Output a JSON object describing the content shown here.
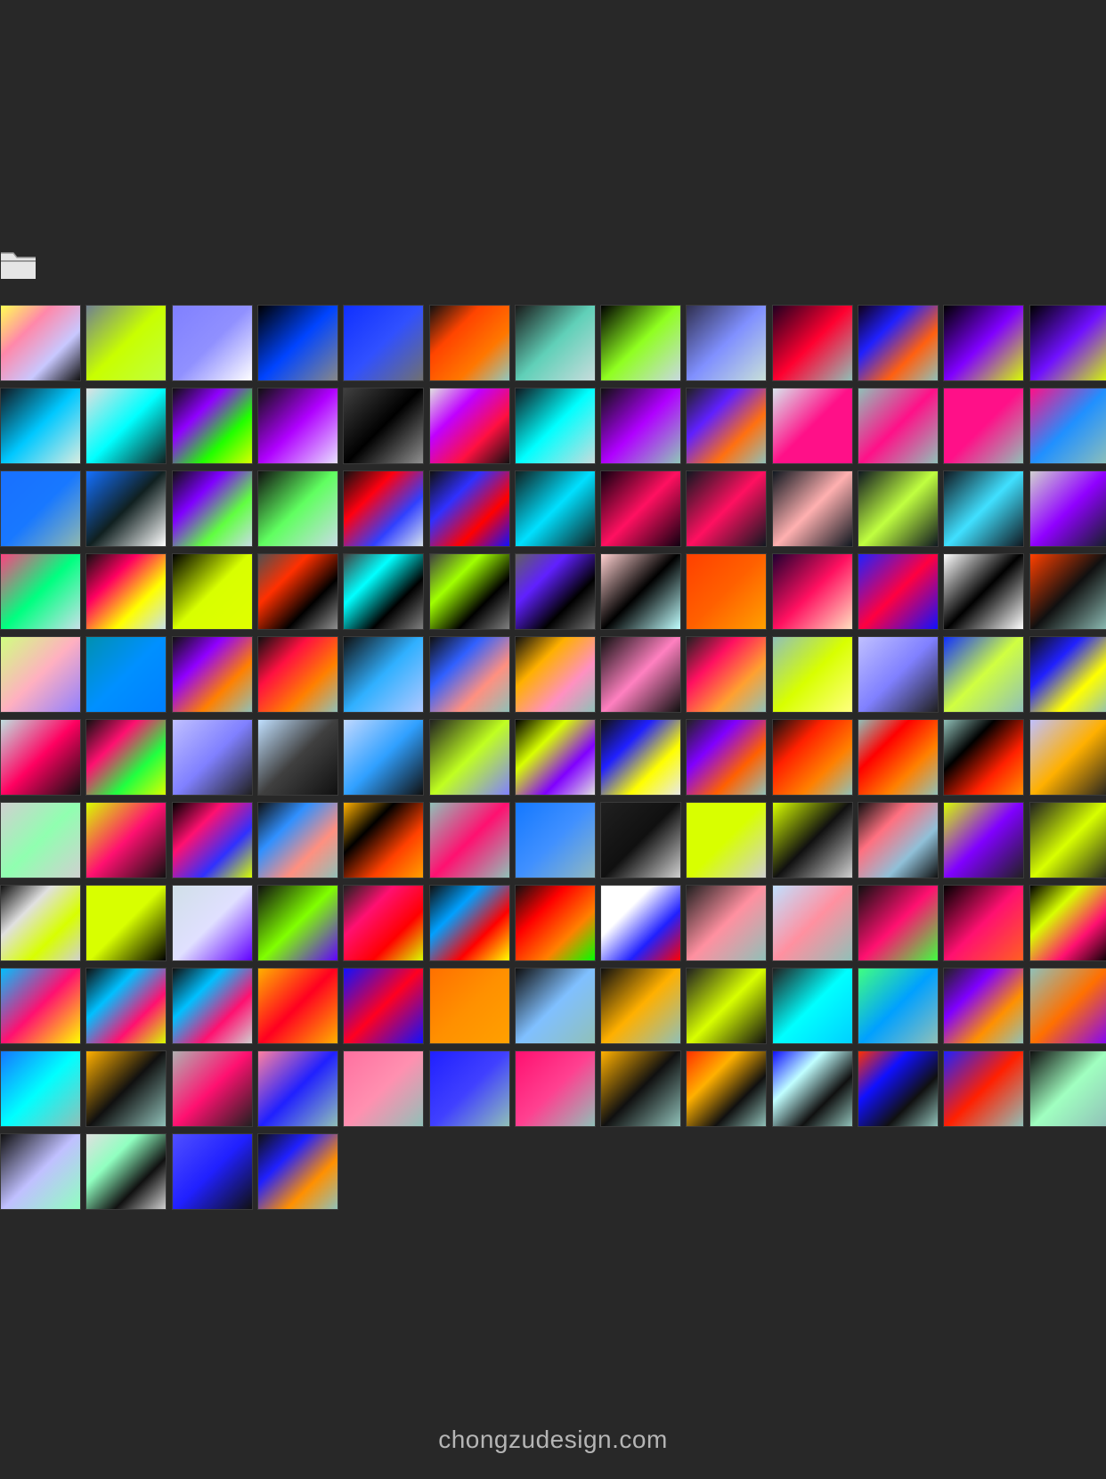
{
  "panel": {
    "folder_icon": "folder-icon",
    "background_color": "#282828"
  },
  "swatches": [
    [
      "#ffff55",
      "#ff88aa",
      "#c8c8ff",
      "#111111"
    ],
    [
      "#708090",
      "#c8ff00",
      "#c0ff40"
    ],
    [
      "#8080ff",
      "#9090ff",
      "#ffffff"
    ],
    [
      "#000000",
      "#0044ff",
      "#888888"
    ],
    [
      "#1030ff",
      "#3050ff",
      "#707070"
    ],
    [
      "#111111",
      "#ff4400",
      "#ff7700",
      "#90c8c0"
    ],
    [
      "#1a1a1a",
      "#60d0b8",
      "#c8dcdc"
    ],
    [
      "#000000",
      "#90ff20",
      "#c8d8e0"
    ],
    [
      "#303050",
      "#8090ff",
      "#c8e0d8"
    ],
    [
      "#200020",
      "#ff0030",
      "#90c0b8"
    ],
    [
      "#100018",
      "#2020ff",
      "#ff6010",
      "#90c0b8"
    ],
    [
      "#000000",
      "#8000ff",
      "#d8ff00"
    ],
    [
      "#000000",
      "#7010ff",
      "#d8ff00"
    ],
    [
      "#101820",
      "#00c8ff",
      "#d8ece0"
    ],
    [
      "#e0e0e0",
      "#00ffff",
      "#102020"
    ],
    [
      "#101010",
      "#9000ff",
      "#20ff00",
      "#d8ff00"
    ],
    [
      "#101010",
      "#b000ff",
      "#e8e0ff"
    ],
    [
      "#404040",
      "#000000",
      "#909090"
    ],
    [
      "#e0e0e0",
      "#c000ff",
      "#ff1040",
      "#101010"
    ],
    [
      "#101820",
      "#00ffff",
      "#c8dcdc"
    ],
    [
      "#101010",
      "#b000ff",
      "#90c8b8"
    ],
    [
      "#202020",
      "#6020ff",
      "#ff7010",
      "#90c0b8"
    ],
    [
      "#d8e4ec",
      "#ff1088",
      "#ff1088"
    ],
    [
      "#90c0b8",
      "#ff1088",
      "#90c0b8"
    ],
    [
      "#ff1088",
      "#ff1088",
      "#90c0b8"
    ],
    [
      "#ff1088",
      "#2090ff",
      "#90c0b8"
    ],
    [
      "#1870ff",
      "#1878ff",
      "#90b8b0"
    ],
    [
      "#1470ff",
      "#102020",
      "#ffffff"
    ],
    [
      "#101010",
      "#8000ff",
      "#60ff40",
      "#c8dce4"
    ],
    [
      "#101010",
      "#60ff60",
      "#c8dce4"
    ],
    [
      "#101010",
      "#ff0010",
      "#3040ff",
      "#d8e4ec"
    ],
    [
      "#101010",
      "#3030ff",
      "#ff0000",
      "#1010ff"
    ],
    [
      "#102020",
      "#00e0ff",
      "#102020"
    ],
    [
      "#100010",
      "#ff1060",
      "#100010"
    ],
    [
      "#101820",
      "#ff1060",
      "#101820"
    ],
    [
      "#101820",
      "#ffb0b0",
      "#101820"
    ],
    [
      "#101820",
      "#c0ff40",
      "#101820"
    ],
    [
      "#101820",
      "#40e0ff",
      "#101820"
    ],
    [
      "#d0d0d0",
      "#9000ff",
      "#102020"
    ],
    [
      "#ff4080",
      "#00ff80",
      "#c8e0e8"
    ],
    [
      "#101010",
      "#ff0060",
      "#ffff00",
      "#c8e0e8"
    ],
    [
      "#000000",
      "#d8ff00",
      "#e0ff00"
    ],
    [
      "#505050",
      "#ff3000",
      "#000000",
      "#909090"
    ],
    [
      "#404040",
      "#00ffff",
      "#000000",
      "#808080"
    ],
    [
      "#404040",
      "#a0ff00",
      "#000000",
      "#808080"
    ],
    [
      "#606060",
      "#6020ff",
      "#000000",
      "#707070"
    ],
    [
      "#ffd0d0",
      "#000000",
      "#c0ffff"
    ],
    [
      "#ff4000",
      "#ff6000",
      "#ffa000"
    ],
    [
      "#200030",
      "#ff1060",
      "#ffe0c0"
    ],
    [
      "#2020ff",
      "#ff0040",
      "#1010ff"
    ],
    [
      "#ffffff",
      "#000000",
      "#ffffff"
    ],
    [
      "#ff4000",
      "#101010",
      "#90c0b8"
    ],
    [
      "#d0ff80",
      "#ffb0c0",
      "#9080ff"
    ],
    [
      "#0090b0",
      "#0090ff",
      "#0080ff"
    ],
    [
      "#101010",
      "#9000ff",
      "#ff8000",
      "#90c0b8"
    ],
    [
      "#101010",
      "#ff1040",
      "#ff8000",
      "#90c0b8"
    ],
    [
      "#101010",
      "#30b0ff",
      "#b0c8ff"
    ],
    [
      "#101010",
      "#3060ff",
      "#ff9080",
      "#90c0b8"
    ],
    [
      "#101010",
      "#ffb000",
      "#ff90c0",
      "#90c0b8"
    ],
    [
      "#101010",
      "#ff80c0",
      "#101010"
    ],
    [
      "#202020",
      "#ff1060",
      "#ffa030",
      "#90c0b8"
    ],
    [
      "#90c0b8",
      "#d8ff00",
      "#ffff80"
    ],
    [
      "#c0c0ff",
      "#8080ff",
      "#202020"
    ],
    [
      "#1030ff",
      "#d0ff40",
      "#90c0b8"
    ],
    [
      "#101010",
      "#2020ff",
      "#ffff00",
      "#90c0b8"
    ],
    [
      "#c0e0e0",
      "#ff0060",
      "#101010"
    ],
    [
      "#101010",
      "#ff1070",
      "#20ff40",
      "#d8ff00"
    ],
    [
      "#c0c0ff",
      "#8080ff",
      "#202020"
    ],
    [
      "#c0e0ff",
      "#404040",
      "#101010"
    ],
    [
      "#c0d8ff",
      "#30a0ff",
      "#101010"
    ],
    [
      "#202020",
      "#c0ff20",
      "#8080ff"
    ],
    [
      "#000000",
      "#d8ff00",
      "#8000ff",
      "#e0e0e0"
    ],
    [
      "#101010",
      "#2020ff",
      "#ffff00",
      "#e8e8e8"
    ],
    [
      "#202020",
      "#8000ff",
      "#ff6000",
      "#90c0b8"
    ],
    [
      "#101010",
      "#ff2000",
      "#ff8000",
      "#90c0b8"
    ],
    [
      "#90c0b8",
      "#ff0000",
      "#ff8000",
      "#90c0b8"
    ],
    [
      "#90c0b8",
      "#000000",
      "#ff2000",
      "#ff9000"
    ],
    [
      "#c0c0ff",
      "#ffb000",
      "#202020"
    ],
    [
      "#d0d0d0",
      "#90ffb0",
      "#d0d0d0"
    ],
    [
      "#d8ff00",
      "#ff1070",
      "#101010"
    ],
    [
      "#000000",
      "#ff1070",
      "#3030ff",
      "#d8ff00"
    ],
    [
      "#101010",
      "#3090ff",
      "#ff9080",
      "#90c0b8"
    ],
    [
      "#ffb000",
      "#000000",
      "#ff4000",
      "#ffa000"
    ],
    [
      "#90c0b8",
      "#ff1070",
      "#90c0b8"
    ],
    [
      "#1478ff",
      "#4090ff",
      "#90b8c0"
    ],
    [
      "#202020",
      "#101010",
      "#d0d0d0"
    ],
    [
      "#d8ff00",
      "#d8ff00",
      "#d0d0d0"
    ],
    [
      "#d8ff00",
      "#101010",
      "#d0d0d0"
    ],
    [
      "#101010",
      "#ff7080",
      "#90c0d8",
      "#101010"
    ],
    [
      "#d8ff00",
      "#8000ff",
      "#202020"
    ],
    [
      "#202020",
      "#d8ff00",
      "#202020"
    ],
    [
      "#101010",
      "#e0e0e0",
      "#d8ff00",
      "#d0d0d0"
    ],
    [
      "#d8ff00",
      "#d8ff00",
      "#000000"
    ],
    [
      "#d0e0e8",
      "#e0e0ff",
      "#6000ff"
    ],
    [
      "#101010",
      "#80ff00",
      "#6000ff"
    ],
    [
      "#202020",
      "#ff1070",
      "#ff0000",
      "#d8ff00"
    ],
    [
      "#101010",
      "#00a0ff",
      "#ff0000",
      "#ffff00"
    ],
    [
      "#101010",
      "#ff0000",
      "#ff8000",
      "#00ff00"
    ],
    [
      "#ffffff",
      "#ffffff",
      "#2020ff",
      "#ff0000"
    ],
    [
      "#202020",
      "#ff90a0",
      "#90c0b8"
    ],
    [
      "#c0e0ff",
      "#ff90a0",
      "#90c0b8"
    ],
    [
      "#101010",
      "#ff1070",
      "#40ff40"
    ],
    [
      "#000000",
      "#ff1070",
      "#ff6020"
    ],
    [
      "#000000",
      "#d8ff00",
      "#ff1070",
      "#000000"
    ],
    [
      "#00c0ff",
      "#ff1070",
      "#ffff00"
    ],
    [
      "#101010",
      "#00c0ff",
      "#ff1070",
      "#d8ff00"
    ],
    [
      "#101010",
      "#00c0ff",
      "#ff1070",
      "#d0d0d0"
    ],
    [
      "#ffb000",
      "#ff0020",
      "#ffb000"
    ],
    [
      "#1010ff",
      "#ff0020",
      "#1010ff"
    ],
    [
      "#ff7000",
      "#ff9000",
      "#ffa000"
    ],
    [
      "#101010",
      "#80c0ff",
      "#90c0b8"
    ],
    [
      "#101010",
      "#ffb000",
      "#90c0b8"
    ],
    [
      "#202020",
      "#d8ff00",
      "#101010"
    ],
    [
      "#202020",
      "#00ffff",
      "#00d0ff"
    ],
    [
      "#40ff80",
      "#00a0ff",
      "#90c0b8"
    ],
    [
      "#202020",
      "#8000ff",
      "#ff9000",
      "#90c0b8"
    ],
    [
      "#90c0b8",
      "#ff7000",
      "#8000ff"
    ],
    [
      "#1478ff",
      "#00ffff",
      "#90c0b8"
    ],
    [
      "#ffb000",
      "#101010",
      "#90c0b8"
    ],
    [
      "#b0b0b0",
      "#ff1070",
      "#202020"
    ],
    [
      "#ff80a0",
      "#2020ff",
      "#90c0b8"
    ],
    [
      "#ff70a0",
      "#ff90b0",
      "#90c0b8"
    ],
    [
      "#2020ff",
      "#4040ff",
      "#90c0b8"
    ],
    [
      "#ff1070",
      "#ff4090",
      "#90c0b8"
    ],
    [
      "#ffb000",
      "#101010",
      "#90c0b8"
    ],
    [
      "#ff3000",
      "#ffb000",
      "#101010",
      "#90c0b8"
    ],
    [
      "#1010ff",
      "#c0ffff",
      "#101010",
      "#90c0b8"
    ],
    [
      "#ff3000",
      "#1010ff",
      "#101010",
      "#90c0b8"
    ],
    [
      "#2020ff",
      "#ff2000",
      "#90c0b8"
    ],
    [
      "#101010",
      "#a0ffc0",
      "#90c0b8"
    ],
    [
      "#101010",
      "#c0c0ff",
      "#90ffc0"
    ],
    [
      "#e0e0e0",
      "#90ffc0",
      "#101010",
      "#d0d0d0"
    ],
    [
      "#5050ff",
      "#2020ff",
      "#101010"
    ],
    [
      "#101010",
      "#2020ff",
      "#ff9000",
      "#90c0b8"
    ]
  ],
  "watermark": {
    "text": "chongzudesign.com"
  }
}
